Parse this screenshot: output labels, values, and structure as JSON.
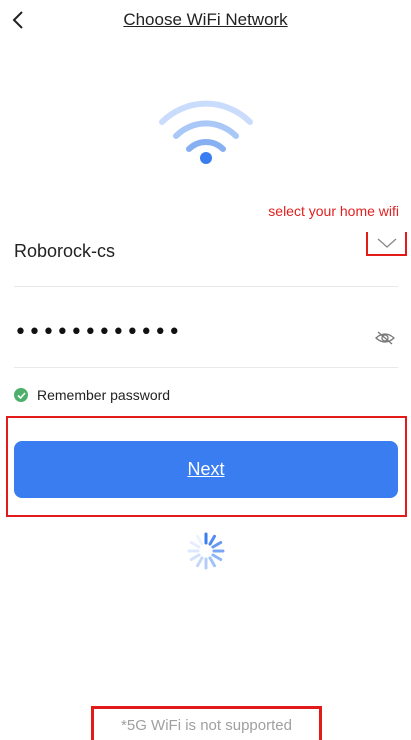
{
  "header": {
    "title": "Choose WiFi Network"
  },
  "annotations": {
    "select_hint": "select your home wifi"
  },
  "network": {
    "ssid": "Roborock-cs"
  },
  "password": {
    "masked_value": "••••••••••••"
  },
  "remember": {
    "label": "Remember password",
    "checked": true
  },
  "actions": {
    "next_label": "Next"
  },
  "footer": {
    "note": "*5G WiFi is not supported"
  },
  "colors": {
    "accent": "#3a7df0",
    "annotation": "#e21a1a",
    "check": "#4caf6a"
  },
  "icons": {
    "back": "chevron-left-icon",
    "wifi": "wifi-icon",
    "dropdown": "chevron-down-icon",
    "eye": "eye-off-icon",
    "spinner": "loading-spinner-icon"
  }
}
